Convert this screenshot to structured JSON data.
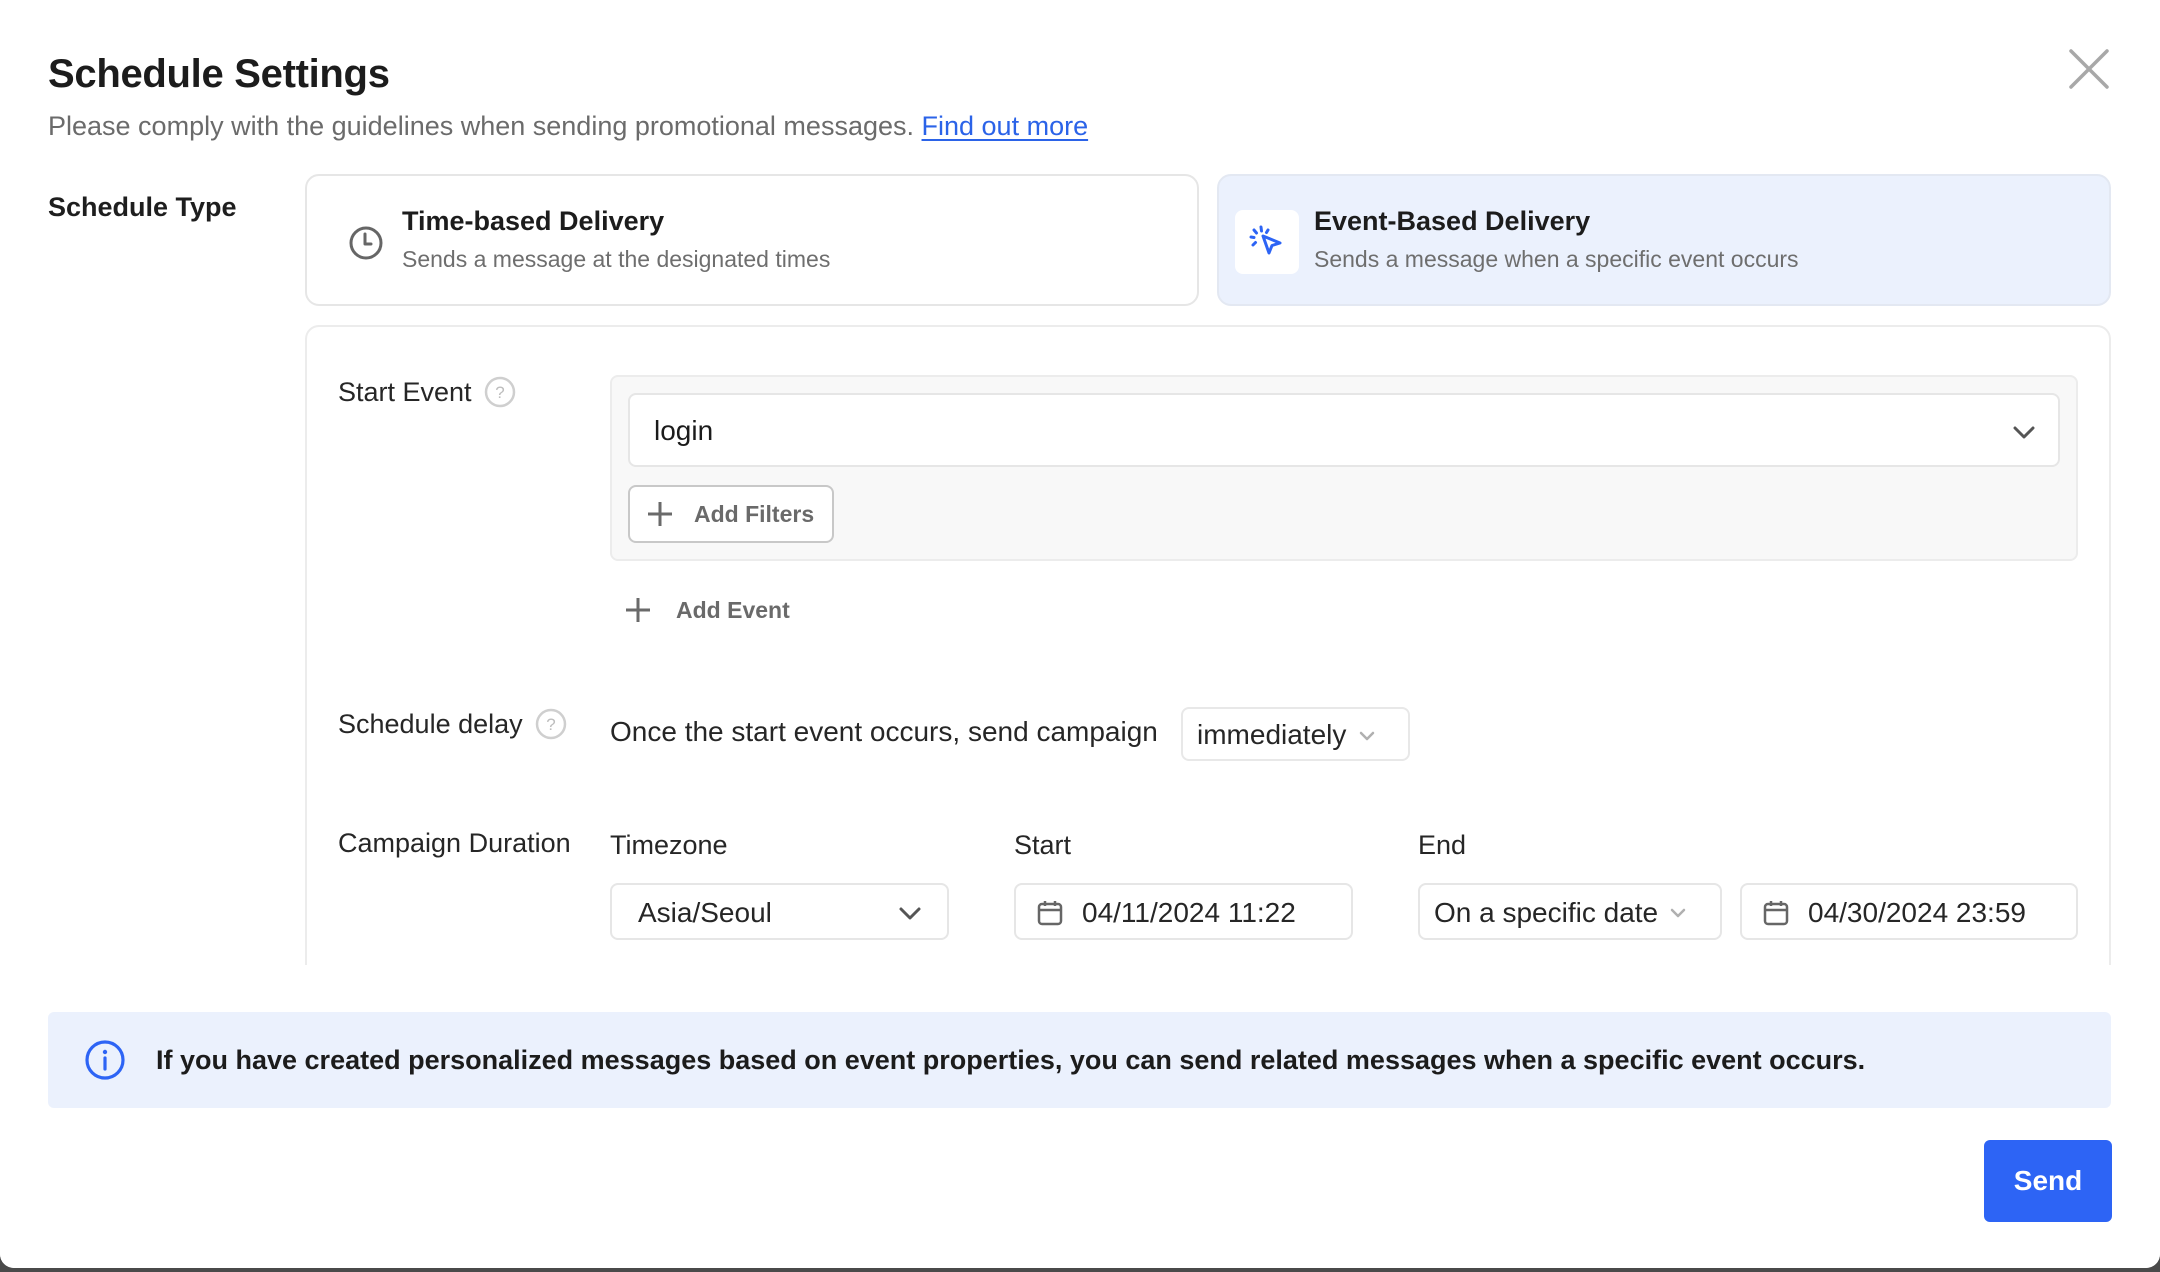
{
  "dialog": {
    "title": "Schedule Settings",
    "subtitle": "Please comply with the guidelines when sending promotional messages.",
    "link_label": "Find out more",
    "close_icon": "close-icon"
  },
  "schedule_type": {
    "label": "Schedule Type",
    "options": [
      {
        "title": "Time-based Delivery",
        "description": "Sends a message at the designated times",
        "icon": "clock-icon",
        "selected": false
      },
      {
        "title": "Event-Based Delivery",
        "description": "Sends a message when a specific event occurs",
        "icon": "cursor-click-icon",
        "selected": true
      }
    ]
  },
  "start_event": {
    "label": "Start Event",
    "help_icon": "question-circle-icon",
    "selected_event": "login",
    "add_filters_label": "Add Filters",
    "add_event_label": "Add Event"
  },
  "schedule_delay": {
    "label": "Schedule delay",
    "help_icon": "question-circle-icon",
    "text": "Once the start event occurs, send campaign",
    "selected": "immediately"
  },
  "campaign_duration": {
    "label": "Campaign Duration",
    "timezone_label": "Timezone",
    "timezone_value": "Asia/Seoul",
    "start_label": "Start",
    "start_value": "04/11/2024 11:22",
    "end_label": "End",
    "end_mode": "On a specific date",
    "end_value": "04/30/2024 23:59"
  },
  "info_banner": {
    "icon": "info-icon",
    "message": "If you have created personalized messages based on event properties, you can send related messages when a specific event occurs."
  },
  "footer": {
    "send_label": "Send"
  },
  "colors": {
    "accent": "#2d64f5",
    "link": "#2b63e8",
    "selected_card_bg": "#ebf1fd",
    "banner_bg": "#ebf1fd"
  }
}
